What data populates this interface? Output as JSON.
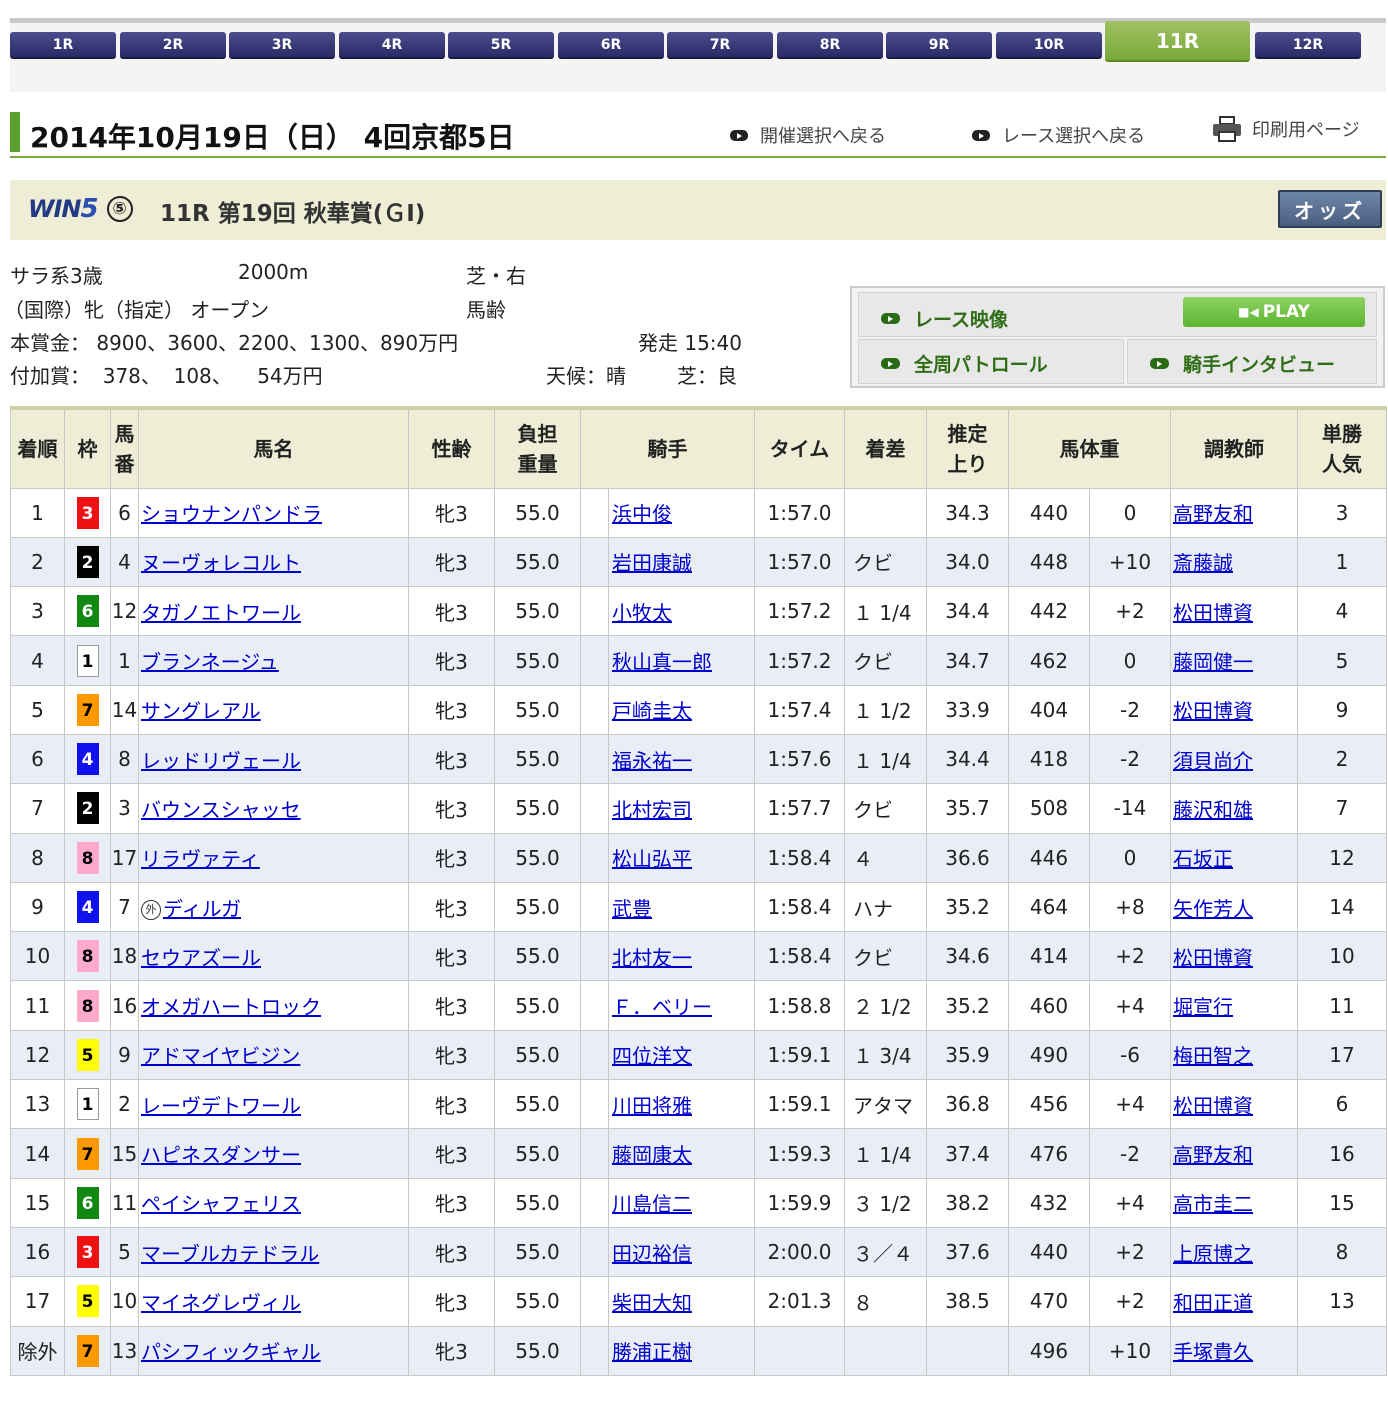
{
  "race_tabs": [
    "1R",
    "2R",
    "3R",
    "4R",
    "5R",
    "6R",
    "7R",
    "8R",
    "9R",
    "10R",
    "11R",
    "12R"
  ],
  "active_tab": "11R",
  "header": {
    "title": "2014年10月19日（日） 4回京都5日",
    "link_meeting": "開催選択へ戻る",
    "link_race": "レース選択へ戻る",
    "link_print": "印刷用ページ"
  },
  "race": {
    "win5_text": "WIN",
    "win5_five": "5",
    "win5_circle": "⑤",
    "name": "11R 第19回 秋華賞(ＧⅠ)",
    "odds_button": "オッズ"
  },
  "info": {
    "class": "サラ系3歳",
    "distance": "2000m",
    "course": "芝・右",
    "conditions": "（国際）牝（指定） オープン",
    "weight_rule": "馬齢",
    "prize": "本賞金： 8900、3600、2200、1300、890万円",
    "start": "発走 15:40",
    "added_prize": "付加賞：  378、  108、    54万円",
    "weather": "天候：晴",
    "going": "芝：良"
  },
  "video": {
    "race_video": "レース映像",
    "play": "PLAY",
    "patrol": "全周パトロール",
    "interview": "騎手インタビュー"
  },
  "columns": {
    "rank": "着順",
    "waku": "枠",
    "num": "馬\n番",
    "horse": "馬名",
    "sexage": "性齢",
    "weight": "負担\n重量",
    "jockey": "騎手",
    "time": "タイム",
    "margin": "着差",
    "last3f": "推定\n上り",
    "bodyweight": "馬体重",
    "trainer": "調教師",
    "pop": "単勝\n人気"
  },
  "waku_colors": {
    "1": {
      "bg": "#ffffff",
      "fg": "#000000",
      "border": "#999999"
    },
    "2": {
      "bg": "#000000",
      "fg": "#ffffff",
      "border": "#000000"
    },
    "3": {
      "bg": "#ee1111",
      "fg": "#ffffff",
      "border": "#ee1111"
    },
    "4": {
      "bg": "#1111ee",
      "fg": "#ffffff",
      "border": "#1111ee"
    },
    "5": {
      "bg": "#ffff00",
      "fg": "#000000",
      "border": "#ffff00"
    },
    "6": {
      "bg": "#118811",
      "fg": "#ffffff",
      "border": "#118811"
    },
    "7": {
      "bg": "#ff9900",
      "fg": "#000000",
      "border": "#ff9900"
    },
    "8": {
      "bg": "#ffaacc",
      "fg": "#000000",
      "border": "#ffaacc"
    }
  },
  "rows": [
    {
      "rank": "1",
      "waku": "3",
      "num": "6",
      "gai": "",
      "horse": "ショウナンパンドラ",
      "sexage": "牝3",
      "weight": "55.0",
      "jockey": "浜中俊",
      "time": "1:57.0",
      "margin": "",
      "last3f": "34.3",
      "bw": "440",
      "bwdiff": "0",
      "trainer": "高野友和",
      "pop": "3"
    },
    {
      "rank": "2",
      "waku": "2",
      "num": "4",
      "gai": "",
      "horse": "ヌーヴォレコルト",
      "sexage": "牝3",
      "weight": "55.0",
      "jockey": "岩田康誠",
      "time": "1:57.0",
      "margin": "クビ",
      "last3f": "34.0",
      "bw": "448",
      "bwdiff": "+10",
      "trainer": "斎藤誠",
      "pop": "1"
    },
    {
      "rank": "3",
      "waku": "6",
      "num": "12",
      "gai": "",
      "horse": "タガノエトワール",
      "sexage": "牝3",
      "weight": "55.0",
      "jockey": "小牧太",
      "time": "1:57.2",
      "margin": "１ 1/4",
      "last3f": "34.4",
      "bw": "442",
      "bwdiff": "+2",
      "trainer": "松田博資",
      "pop": "4"
    },
    {
      "rank": "4",
      "waku": "1",
      "num": "1",
      "gai": "",
      "horse": "ブランネージュ",
      "sexage": "牝3",
      "weight": "55.0",
      "jockey": "秋山真一郎",
      "time": "1:57.2",
      "margin": "クビ",
      "last3f": "34.7",
      "bw": "462",
      "bwdiff": "0",
      "trainer": "藤岡健一",
      "pop": "5"
    },
    {
      "rank": "5",
      "waku": "7",
      "num": "14",
      "gai": "",
      "horse": "サングレアル",
      "sexage": "牝3",
      "weight": "55.0",
      "jockey": "戸崎圭太",
      "time": "1:57.4",
      "margin": "１ 1/2",
      "last3f": "33.9",
      "bw": "404",
      "bwdiff": "-2",
      "trainer": "松田博資",
      "pop": "9"
    },
    {
      "rank": "6",
      "waku": "4",
      "num": "8",
      "gai": "",
      "horse": "レッドリヴェール",
      "sexage": "牝3",
      "weight": "55.0",
      "jockey": "福永祐一",
      "time": "1:57.6",
      "margin": "１ 1/4",
      "last3f": "34.4",
      "bw": "418",
      "bwdiff": "-2",
      "trainer": "須貝尚介",
      "pop": "2"
    },
    {
      "rank": "7",
      "waku": "2",
      "num": "3",
      "gai": "",
      "horse": "バウンスシャッセ",
      "sexage": "牝3",
      "weight": "55.0",
      "jockey": "北村宏司",
      "time": "1:57.7",
      "margin": "クビ",
      "last3f": "35.7",
      "bw": "508",
      "bwdiff": "-14",
      "trainer": "藤沢和雄",
      "pop": "7"
    },
    {
      "rank": "8",
      "waku": "8",
      "num": "17",
      "gai": "",
      "horse": "リラヴァティ",
      "sexage": "牝3",
      "weight": "55.0",
      "jockey": "松山弘平",
      "time": "1:58.4",
      "margin": "４",
      "last3f": "36.6",
      "bw": "446",
      "bwdiff": "0",
      "trainer": "石坂正",
      "pop": "12"
    },
    {
      "rank": "9",
      "waku": "4",
      "num": "7",
      "gai": "外",
      "horse": "ディルガ",
      "sexage": "牝3",
      "weight": "55.0",
      "jockey": "武豊",
      "time": "1:58.4",
      "margin": "ハナ",
      "last3f": "35.2",
      "bw": "464",
      "bwdiff": "+8",
      "trainer": "矢作芳人",
      "pop": "14"
    },
    {
      "rank": "10",
      "waku": "8",
      "num": "18",
      "gai": "",
      "horse": "セウアズール",
      "sexage": "牝3",
      "weight": "55.0",
      "jockey": "北村友一",
      "time": "1:58.4",
      "margin": "クビ",
      "last3f": "34.6",
      "bw": "414",
      "bwdiff": "+2",
      "trainer": "松田博資",
      "pop": "10"
    },
    {
      "rank": "11",
      "waku": "8",
      "num": "16",
      "gai": "",
      "horse": "オメガハートロック",
      "sexage": "牝3",
      "weight": "55.0",
      "jockey": "Ｆ．ベリー",
      "time": "1:58.8",
      "margin": "２ 1/2",
      "last3f": "35.2",
      "bw": "460",
      "bwdiff": "+4",
      "trainer": "堀宣行",
      "pop": "11"
    },
    {
      "rank": "12",
      "waku": "5",
      "num": "9",
      "gai": "",
      "horse": "アドマイヤビジン",
      "sexage": "牝3",
      "weight": "55.0",
      "jockey": "四位洋文",
      "time": "1:59.1",
      "margin": "１ 3/4",
      "last3f": "35.9",
      "bw": "490",
      "bwdiff": "-6",
      "trainer": "梅田智之",
      "pop": "17"
    },
    {
      "rank": "13",
      "waku": "1",
      "num": "2",
      "gai": "",
      "horse": "レーヴデトワール",
      "sexage": "牝3",
      "weight": "55.0",
      "jockey": "川田将雅",
      "time": "1:59.1",
      "margin": "アタマ",
      "last3f": "36.8",
      "bw": "456",
      "bwdiff": "+4",
      "trainer": "松田博資",
      "pop": "6"
    },
    {
      "rank": "14",
      "waku": "7",
      "num": "15",
      "gai": "",
      "horse": "ハピネスダンサー",
      "sexage": "牝3",
      "weight": "55.0",
      "jockey": "藤岡康太",
      "time": "1:59.3",
      "margin": "１ 1/4",
      "last3f": "37.4",
      "bw": "476",
      "bwdiff": "-2",
      "trainer": "高野友和",
      "pop": "16"
    },
    {
      "rank": "15",
      "waku": "6",
      "num": "11",
      "gai": "",
      "horse": "ペイシャフェリス",
      "sexage": "牝3",
      "weight": "55.0",
      "jockey": "川島信二",
      "time": "1:59.9",
      "margin": "３ 1/2",
      "last3f": "38.2",
      "bw": "432",
      "bwdiff": "+4",
      "trainer": "高市圭二",
      "pop": "15"
    },
    {
      "rank": "16",
      "waku": "3",
      "num": "5",
      "gai": "",
      "horse": "マーブルカテドラル",
      "sexage": "牝3",
      "weight": "55.0",
      "jockey": "田辺裕信",
      "time": "2:00.0",
      "margin": "３／４",
      "last3f": "37.6",
      "bw": "440",
      "bwdiff": "+2",
      "trainer": "上原博之",
      "pop": "8"
    },
    {
      "rank": "17",
      "waku": "5",
      "num": "10",
      "gai": "",
      "horse": "マイネグレヴィル",
      "sexage": "牝3",
      "weight": "55.0",
      "jockey": "柴田大知",
      "time": "2:01.3",
      "margin": "８",
      "last3f": "38.5",
      "bw": "470",
      "bwdiff": "+2",
      "trainer": "和田正道",
      "pop": "13"
    },
    {
      "rank": "除外",
      "waku": "7",
      "num": "13",
      "gai": "",
      "horse": "パシフィックギャル",
      "sexage": "牝3",
      "weight": "55.0",
      "jockey": "勝浦正樹",
      "time": "",
      "margin": "",
      "last3f": "",
      "bw": "496",
      "bwdiff": "+10",
      "trainer": "手塚貴久",
      "pop": ""
    }
  ]
}
